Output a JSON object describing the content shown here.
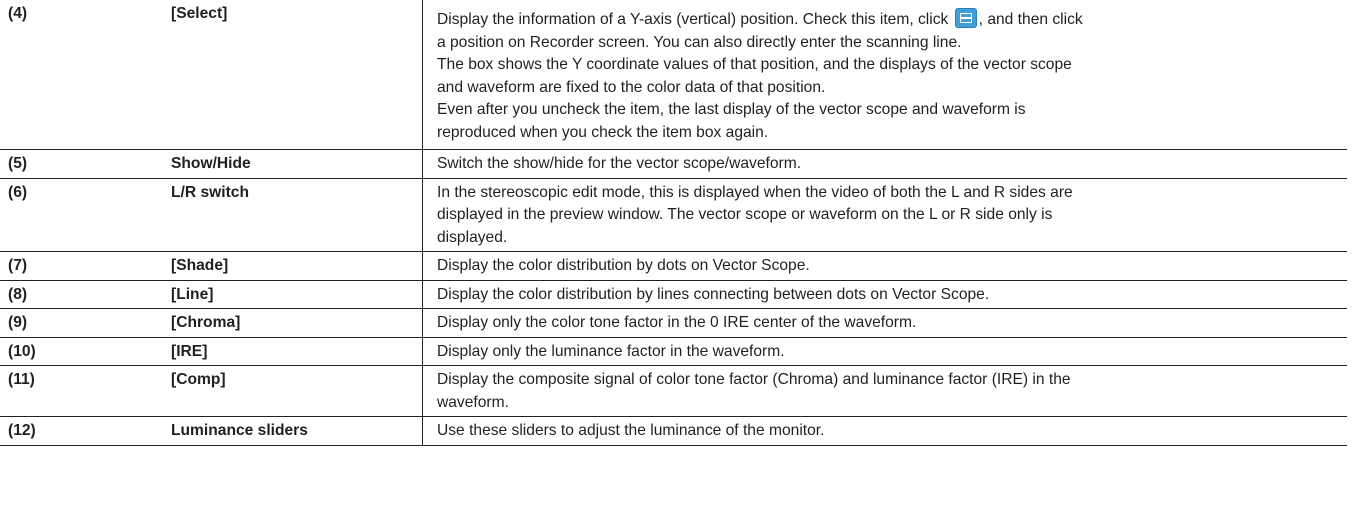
{
  "rows": [
    {
      "num": "(4)",
      "name": "[Select]",
      "desc": {
        "l1_before_icon": "Display the information of a Y-axis (vertical) position. Check this item, click ",
        "icon": "scan-line-select-icon",
        "l1_after_icon": ", and then click",
        "l2": "a position on Recorder screen. You can also directly enter the scanning line.",
        "l3": "The box shows the Y coordinate values of that position, and the displays of the vector scope",
        "l4": "and waveform are fixed to the color data of that position.",
        "l5": "Even after you uncheck the item, the last display of the vector scope and waveform is",
        "l6": "reproduced when you check the item box again."
      }
    },
    {
      "num": "(5)",
      "name": "Show/Hide",
      "desc": {
        "l1": "Switch the show/hide for the vector scope/waveform."
      }
    },
    {
      "num": "(6)",
      "name": "L/R switch",
      "desc": {
        "l1": "In the stereoscopic edit mode, this is displayed when the video of both the L and R sides are",
        "l2": "displayed in the preview window. The vector scope or waveform on the L or R side only is",
        "l3": "displayed."
      }
    },
    {
      "num": "(7)",
      "name": "[Shade]",
      "desc": {
        "l1": "Display the color distribution by dots on Vector Scope."
      }
    },
    {
      "num": "(8)",
      "name": "[Line]",
      "desc": {
        "l1": "Display the color distribution by lines connecting between dots on Vector Scope."
      }
    },
    {
      "num": "(9)",
      "name": "[Chroma]",
      "desc": {
        "l1": "Display only the color tone factor in the 0 IRE center of the waveform."
      }
    },
    {
      "num": "(10)",
      "name": "[IRE]",
      "desc": {
        "l1": "Display only the luminance factor in the waveform."
      }
    },
    {
      "num": "(11)",
      "name": "[Comp]",
      "desc": {
        "l1": "Display the composite signal of color tone factor (Chroma) and luminance factor (IRE) in the",
        "l2": "waveform."
      }
    },
    {
      "num": "(12)",
      "name": "Luminance sliders",
      "desc": {
        "l1": "Use these sliders to adjust the luminance of the monitor."
      }
    }
  ],
  "colors": {
    "text": "#231f20",
    "rule": "#231f20",
    "icon_bg": "#3f9fd6"
  }
}
